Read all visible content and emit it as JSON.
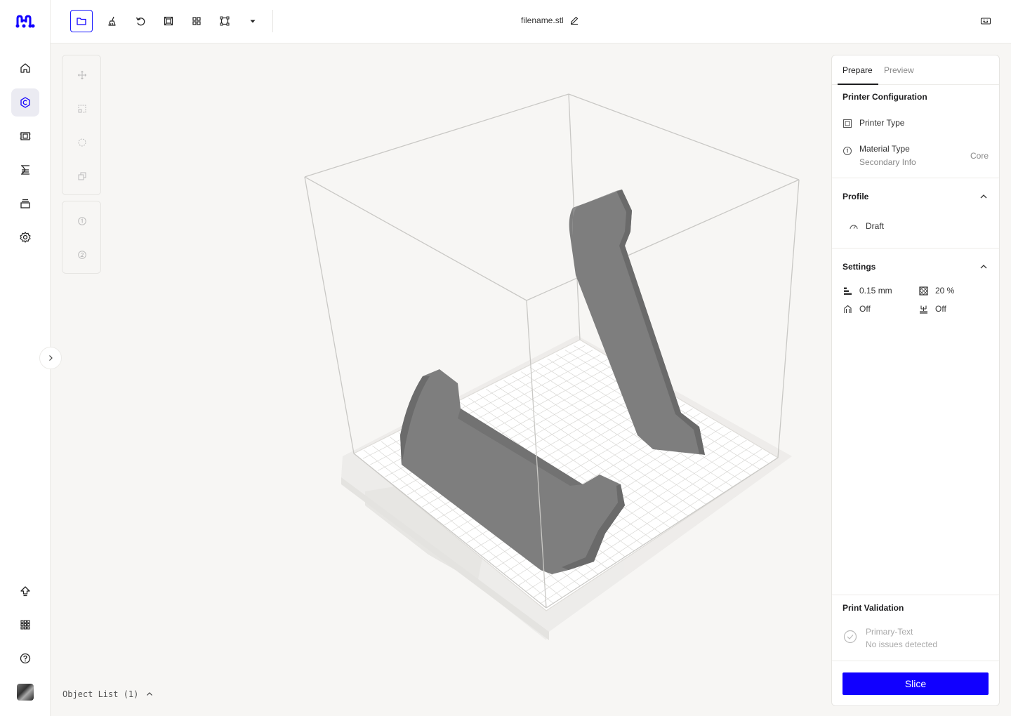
{
  "app": {
    "filename": "filename.stl",
    "accent_color": "#1100ff"
  },
  "rail": {
    "logo_icon": "brand-logo",
    "items": [
      {
        "name": "home",
        "icon": "home-icon",
        "active": false
      },
      {
        "name": "prepare",
        "icon": "hexagon-icon",
        "active": true
      },
      {
        "name": "materials",
        "icon": "film-icon",
        "active": false
      },
      {
        "name": "queue",
        "icon": "hourglass-icon",
        "active": false
      },
      {
        "name": "archive",
        "icon": "archive-icon",
        "active": false
      },
      {
        "name": "settings",
        "icon": "gear-icon",
        "active": false
      }
    ],
    "bottom_items": [
      {
        "name": "upload",
        "icon": "upload-icon"
      },
      {
        "name": "apps",
        "icon": "grid-icon"
      },
      {
        "name": "help",
        "icon": "help-icon"
      }
    ]
  },
  "toolbar": {
    "tools": [
      {
        "name": "open-file",
        "icon": "folder-icon",
        "active": true
      },
      {
        "name": "clean",
        "icon": "broom-icon",
        "active": false
      },
      {
        "name": "undo",
        "icon": "undo-icon",
        "active": false
      },
      {
        "name": "frame",
        "icon": "frame-icon",
        "active": false
      },
      {
        "name": "arrange",
        "icon": "arrange-icon",
        "active": false
      },
      {
        "name": "bounding",
        "icon": "crop-icon",
        "active": false
      },
      {
        "name": "more",
        "icon": "caret-down-icon",
        "active": false
      }
    ]
  },
  "object_list": {
    "label": "Object List (1)"
  },
  "panel": {
    "tabs": [
      "Prepare",
      "Preview"
    ],
    "active_tab": "Prepare",
    "printer_config": {
      "title": "Printer Configuration",
      "printer_type": "Printer Type",
      "material_type": "Material Type",
      "material_secondary": "Secondary Info",
      "material_value": "Core"
    },
    "profile": {
      "title": "Profile",
      "value": "Draft"
    },
    "settings": {
      "title": "Settings",
      "layer_height": "0.15 mm",
      "infill": "20 %",
      "supports": "Off",
      "adhesion": "Off"
    },
    "validation": {
      "title": "Print Validation",
      "primary": "Primary-Text",
      "secondary": "No issues detected"
    },
    "slice_label": "Slice"
  }
}
